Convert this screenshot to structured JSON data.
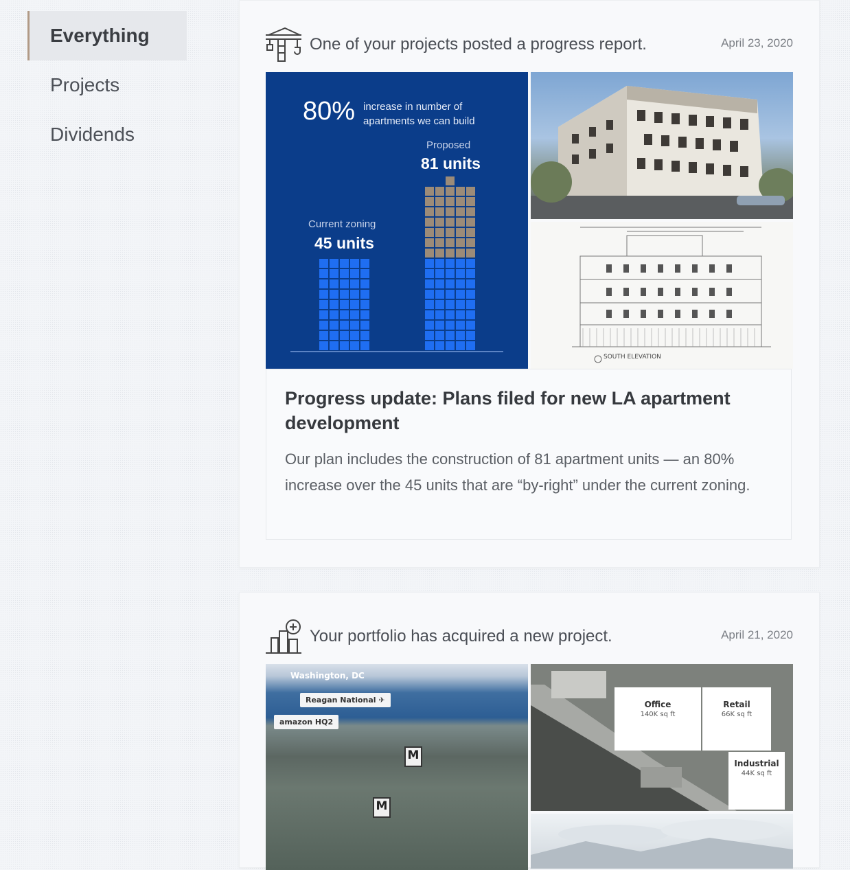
{
  "sidebar": {
    "items": [
      {
        "label": "Everything"
      },
      {
        "label": "Projects"
      },
      {
        "label": "Dividends"
      }
    ]
  },
  "feed": [
    {
      "icon": "crane-icon",
      "header": "One of your projects posted a progress report.",
      "date": "April 23, 2020",
      "infographic": {
        "pct": "80%",
        "pct_desc": "increase in number of apartments we can build",
        "proposed_label": "Proposed",
        "proposed_units": "81 units",
        "current_label": "Current zoning",
        "current_units": "45 units"
      },
      "elevation_label": "SOUTH ELEVATION",
      "title": "Progress update: Plans filed for new LA apartment development",
      "body": "Our plan includes the construction of 81 apartment units — an 80% increase over the 45 units that are “by-right” under the current zoning."
    },
    {
      "icon": "building-plus-icon",
      "header": "Your portfolio has acquired a new project.",
      "date": "April 21, 2020",
      "aerial": {
        "city": "Washington, DC",
        "airport": "Reagan National ✈",
        "hq": "amazon HQ2",
        "metro": "M"
      },
      "site": {
        "office_name": "Office",
        "office_size": "140K sq ft",
        "retail_name": "Retail",
        "retail_size": "66K sq ft",
        "industrial_name": "Industrial",
        "industrial_size": "44K sq ft"
      }
    }
  ],
  "colors": {
    "accent": "#b19a86",
    "infographic_bg": "#0b3d8a",
    "unit_blue": "#1f6ef2",
    "unit_tan": "#9c8b78"
  }
}
